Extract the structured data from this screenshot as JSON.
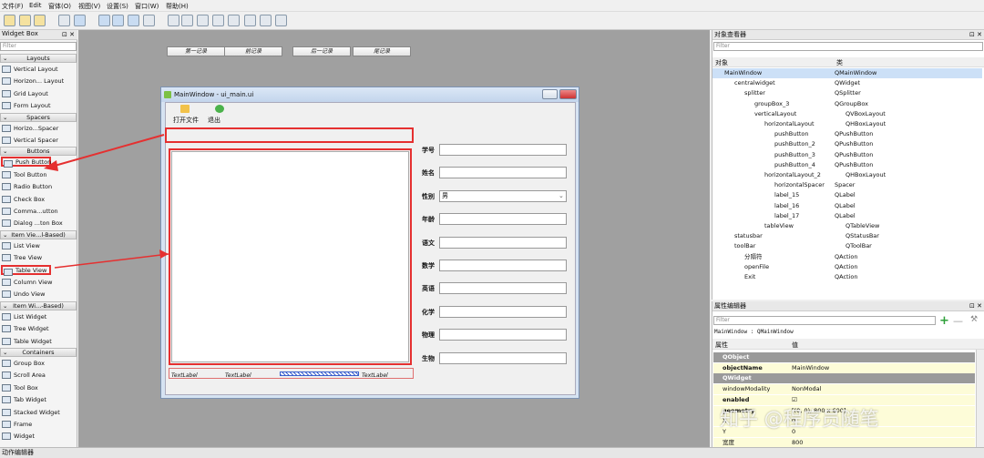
{
  "menu": [
    "文件(F)",
    "Edit",
    "窗体(O)",
    "视图(V)",
    "设置(S)",
    "窗口(W)",
    "帮助(H)"
  ],
  "widget_box": {
    "title": "Widget Box",
    "filter": "Filter",
    "buttons": "⊡ ✕",
    "categories": [
      {
        "label": "Layouts"
      },
      {
        "label": "Spacers"
      },
      {
        "label": "Buttons"
      },
      {
        "label": "Item Vie...l-Based)"
      },
      {
        "label": "Item Wi...-Based)"
      },
      {
        "label": "Containers"
      }
    ],
    "items": [
      "Vertical Layout",
      "Horizon... Layout",
      "Grid Layout",
      "Form Layout",
      "Horizo...Spacer",
      "Vertical Spacer",
      "Push Button",
      "Tool Button",
      "Radio Button",
      "Check Box",
      "Comma...utton",
      "Dialog ...ton Box",
      "List View",
      "Tree View",
      "Table View",
      "Column View",
      "Undo View",
      "List Widget",
      "Tree Widget",
      "Table Widget",
      "Group Box",
      "Scroll Area",
      "Tool Box",
      "Tab Widget",
      "Stacked Widget",
      "Frame",
      "Widget"
    ]
  },
  "main_window": {
    "title": "MainWindow - ui_main.ui",
    "actions": [
      "打开文件",
      "退出"
    ],
    "buttons": [
      "第一记录",
      "前记录",
      "后一记录",
      "尾记录"
    ],
    "form": [
      {
        "label": "学号",
        "value": ""
      },
      {
        "label": "姓名",
        "value": ""
      },
      {
        "label": "性别",
        "value": "男"
      },
      {
        "label": "年龄",
        "value": ""
      },
      {
        "label": "语文",
        "value": ""
      },
      {
        "label": "数学",
        "value": ""
      },
      {
        "label": "英语",
        "value": ""
      },
      {
        "label": "化学",
        "value": ""
      },
      {
        "label": "物理",
        "value": ""
      },
      {
        "label": "生物",
        "value": ""
      }
    ],
    "status_labels": [
      "TextLabel",
      "TextLabel",
      "TextLabel"
    ]
  },
  "object_inspector": {
    "title": "对象查看器",
    "filter": "Filter",
    "col_object": "对象",
    "col_class": "类",
    "rows": [
      {
        "name": "MainWindow",
        "cls": "QMainWindow"
      },
      {
        "name": "centralwidget",
        "cls": "QWidget"
      },
      {
        "name": "splitter",
        "cls": "QSplitter"
      },
      {
        "name": "groupBox_3",
        "cls": "QGroupBox"
      },
      {
        "name": "verticalLayout",
        "cls": "QVBoxLayout"
      },
      {
        "name": "horizontalLayout",
        "cls": "QHBoxLayout"
      },
      {
        "name": "pushButton",
        "cls": "QPushButton"
      },
      {
        "name": "pushButton_2",
        "cls": "QPushButton"
      },
      {
        "name": "pushButton_3",
        "cls": "QPushButton"
      },
      {
        "name": "pushButton_4",
        "cls": "QPushButton"
      },
      {
        "name": "horizontalLayout_2",
        "cls": "QHBoxLayout"
      },
      {
        "name": "horizontalSpacer",
        "cls": "Spacer"
      },
      {
        "name": "label_15",
        "cls": "QLabel"
      },
      {
        "name": "label_16",
        "cls": "QLabel"
      },
      {
        "name": "label_17",
        "cls": "QLabel"
      },
      {
        "name": "tableView",
        "cls": "QTableView"
      },
      {
        "name": "statusbar",
        "cls": "QStatusBar"
      },
      {
        "name": "toolBar",
        "cls": "QToolBar"
      },
      {
        "name": "分隔符",
        "cls": "QAction"
      },
      {
        "name": "openFile",
        "cls": "QAction"
      },
      {
        "name": "Exit",
        "cls": "QAction"
      }
    ]
  },
  "property_editor": {
    "title": "属性编辑器",
    "filter": "Filter",
    "context": "MainWindow : QMainWindow",
    "col_prop": "属性",
    "col_value": "值",
    "rows": [
      {
        "k": "QObject",
        "v": "",
        "sec": true
      },
      {
        "k": "objectName",
        "v": "MainWindow"
      },
      {
        "k": "QWidget",
        "v": "",
        "sec": true
      },
      {
        "k": "windowModality",
        "v": "NonModal"
      },
      {
        "k": "enabled",
        "v": "☑"
      },
      {
        "k": "geometry",
        "v": "[(0, 0), 800 x 600]"
      },
      {
        "k": "X",
        "v": "0"
      },
      {
        "k": "Y",
        "v": "0"
      },
      {
        "k": "宽度",
        "v": "800"
      }
    ]
  },
  "bottom_bar": "动作编辑器",
  "watermark": "知乎 @程序员随笔",
  "colors": {
    "highlight": "#e53030",
    "selection": "#cce0f7"
  }
}
